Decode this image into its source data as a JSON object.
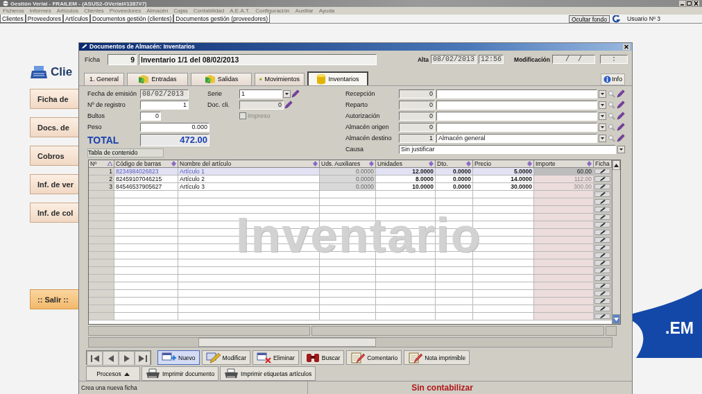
{
  "app": {
    "title": "Gestión Verial - FRAILEM - (ASUS2-GVerial#1387#7)",
    "menu": [
      {
        "label": "Ficheros",
        "disabled": true
      },
      {
        "label": "Informes",
        "disabled": true
      },
      {
        "label": "Artículos",
        "disabled": true
      },
      {
        "label": "Clientes",
        "disabled": true
      },
      {
        "label": "Proveedores",
        "disabled": true
      },
      {
        "label": "Almacén",
        "disabled": true
      },
      {
        "label": "Cajas",
        "disabled": true
      },
      {
        "label": "Contabilidad",
        "disabled": true
      },
      {
        "label": "A.E.A.T.",
        "disabled": true
      },
      {
        "label": "Configuración",
        "disabled": true
      },
      {
        "label": "Auxiliar",
        "disabled": true
      },
      {
        "label": "Ayuda",
        "disabled": true
      }
    ],
    "module_tabs": [
      "Clientes",
      "Proveedores",
      "Artículos",
      "Documentos gestión (clientes)",
      "Documentos gestión (proveedores)"
    ],
    "hide_background_button": "Ocultar fondo",
    "user": "Usuario Nº 3"
  },
  "side_panel": {
    "title": "Clie",
    "buttons": [
      {
        "label": "Ficha de",
        "kind": "nav"
      },
      {
        "label": "Docs. de",
        "kind": "nav"
      },
      {
        "label": "Cobros",
        "kind": "nav"
      },
      {
        "label": "Inf. de ver",
        "kind": "nav"
      },
      {
        "label": "Inf. de col",
        "kind": "nav"
      },
      {
        "label": ":: Salir ::",
        "kind": "exit"
      }
    ]
  },
  "logo": {
    "text": ".EM"
  },
  "dialog": {
    "title": "Documentos de Almacén: Inventarios",
    "ficha": {
      "label": "Ficha",
      "number": "9",
      "name": "Inventario 1/1 del 08/02/2013"
    },
    "alta": {
      "label": "Alta",
      "date": "08/02/2013",
      "time": "12:56"
    },
    "modificacion": {
      "label": "Modificación",
      "date": "/  /",
      "time": ":"
    },
    "tabs": [
      {
        "label": "1. General",
        "kind": "plain",
        "selected": false
      },
      {
        "label": "Entradas",
        "kind": "box",
        "selected": false
      },
      {
        "label": "Salidas",
        "kind": "box",
        "selected": false
      },
      {
        "label": "Movimientos",
        "kind": "box",
        "selected": false
      },
      {
        "label": "Inventarios",
        "kind": "cylinder",
        "selected": true
      }
    ],
    "info_button": "Info",
    "fecha_emision": {
      "label": "Fecha de emisión",
      "value": "08/02/2013"
    },
    "n_registro": {
      "label": "Nº de registro",
      "value": "1"
    },
    "bultos": {
      "label": "Bultos",
      "value": "0"
    },
    "peso": {
      "label": "Peso",
      "value": "0.000"
    },
    "total": {
      "label": "TOTAL",
      "value": "472.00"
    },
    "serie": {
      "label": "Serie",
      "value": "1"
    },
    "doc_cli": {
      "label": "Doc. cli.",
      "value": "0"
    },
    "impreso": {
      "label": "Impreso",
      "checked": false,
      "disabled": true
    },
    "contents_button": "Tabla de contenido",
    "right_fields": [
      {
        "label": "Recepción",
        "code": "0"
      },
      {
        "label": "Reparto",
        "code": "0"
      },
      {
        "label": "Autorización",
        "code": "0"
      },
      {
        "label": "Almacén origen",
        "code": "0"
      },
      {
        "label": "Almacén destino",
        "code": "1",
        "name": "Almacén general"
      }
    ],
    "causa": {
      "label": "Causa",
      "value": "Sin justificar"
    },
    "grid": {
      "background_label": "Inventario",
      "columns": [
        {
          "label": "Nº",
          "kind": "index",
          "sorted": true
        },
        {
          "label": "Código de barras",
          "kind": "text",
          "sorted": false
        },
        {
          "label": "Nombre del artículo",
          "kind": "text",
          "sorted": false
        },
        {
          "label": "Uds. Auxiliares",
          "kind": "aux",
          "sorted": false
        },
        {
          "label": "Unidades",
          "kind": "number",
          "sorted": false
        },
        {
          "label": "Dto.",
          "kind": "number",
          "sorted": false
        },
        {
          "label": "Precio",
          "kind": "number",
          "sorted": false
        },
        {
          "label": "Importe",
          "kind": "total",
          "sorted": false
        },
        {
          "label": "Ficha",
          "kind": "button"
        }
      ],
      "rows": [
        {
          "selected": true,
          "cells": [
            "1",
            "8234984026823",
            "Artículo 1",
            "0.0000",
            "12.0000",
            "0.0000",
            "5.0000",
            "60.00"
          ]
        },
        {
          "selected": false,
          "cells": [
            "2",
            "82459107046215",
            "Artículo 2",
            "0.0000",
            "8.0000",
            "0.0000",
            "14.0000",
            "112.00"
          ]
        },
        {
          "selected": false,
          "cells": [
            "3",
            "84546537905627",
            "Artículo 3",
            "0.0000",
            "10.0000",
            "0.0000",
            "30.0000",
            "300.00"
          ]
        }
      ]
    },
    "toolbar": [
      {
        "label": "Nuevo",
        "kind": "new",
        "selected": true
      },
      {
        "label": "Modificar",
        "kind": "edit",
        "selected": false
      },
      {
        "label": "Eliminar",
        "kind": "delete",
        "selected": false
      },
      {
        "label": "Buscar",
        "kind": "search",
        "selected": false
      },
      {
        "label": "Comentario",
        "kind": "note",
        "selected": false
      },
      {
        "label": "Nota imprimible",
        "kind": "note",
        "selected": false
      }
    ],
    "toolbar2": [
      {
        "label": "Procesos",
        "kind": "menu"
      },
      {
        "label": "Imprimir documento",
        "kind": "print"
      },
      {
        "label": "Imprimir etiquetas artículos",
        "kind": "print"
      }
    ],
    "status": {
      "message": "Crea una nueva ficha",
      "accounting": "Sin contabilizar"
    }
  }
}
